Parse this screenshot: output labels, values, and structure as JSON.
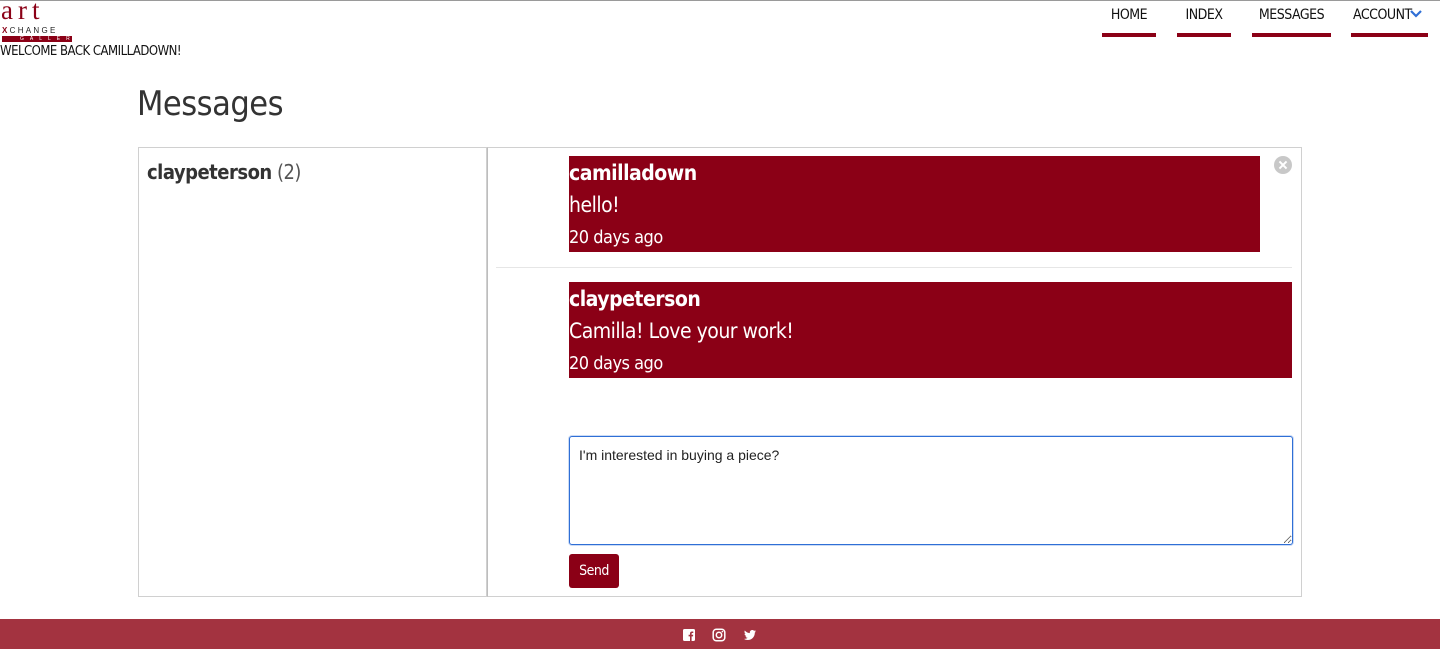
{
  "brand": {
    "logo_top": "art",
    "logo_mid_x": "X",
    "logo_mid_rest": "CHANGE",
    "logo_bottom": "GALLERY",
    "accent_color": "#8b0016",
    "footer_color": "#a33340"
  },
  "header": {
    "welcome": "WELCOME BACK CAMILLADOWN!"
  },
  "nav": {
    "home": "HOME",
    "index": "INDEX",
    "messages": "MESSAGES",
    "account": "ACCOUNT"
  },
  "page": {
    "title": "Messages"
  },
  "threads": [
    {
      "name": "claypeterson",
      "count": "(2)"
    }
  ],
  "messages": [
    {
      "author": "camilladown",
      "text": "hello!",
      "time": "20 days ago"
    },
    {
      "author": "claypeterson",
      "text": "Camilla! Love your work!",
      "time": "20 days ago"
    }
  ],
  "reply": {
    "value": "I'm interested in buying a piece?",
    "send_label": "Send"
  },
  "footer": {
    "icons": [
      "facebook-icon",
      "instagram-icon",
      "twitter-icon"
    ]
  }
}
